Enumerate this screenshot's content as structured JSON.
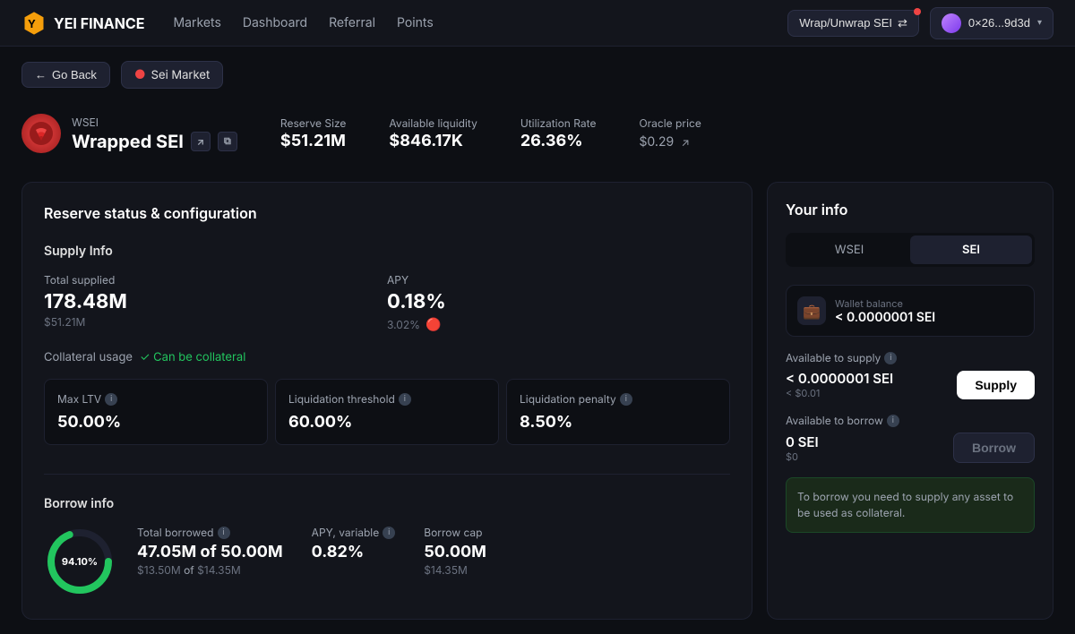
{
  "app": {
    "logo_text": "YEI FINANCE",
    "logo_icon": "⬡"
  },
  "nav": {
    "items": [
      {
        "id": "markets",
        "label": "Markets"
      },
      {
        "id": "dashboard",
        "label": "Dashboard"
      },
      {
        "id": "referral",
        "label": "Referral"
      },
      {
        "id": "points",
        "label": "Points"
      }
    ]
  },
  "header": {
    "wrap_btn_label": "Wrap/Unwrap SEI",
    "wallet_address": "0×26...9d3d"
  },
  "breadcrumb": {
    "back_label": "Go Back",
    "market_label": "Sei Market"
  },
  "asset": {
    "ticker": "WSEI",
    "name": "Wrapped SEI",
    "reserve_size_label": "Reserve Size",
    "reserve_size_value": "$51.21M",
    "available_liquidity_label": "Available liquidity",
    "available_liquidity_value": "$846.17K",
    "utilization_rate_label": "Utilization Rate",
    "utilization_rate_value": "26.36%",
    "oracle_price_label": "Oracle price",
    "oracle_price_value": "$0.29"
  },
  "left_panel": {
    "title": "Reserve status & configuration",
    "supply_info": {
      "section_label": "Supply Info",
      "total_supplied_label": "Total supplied",
      "total_supplied_value": "178.48M",
      "total_supplied_usd": "$51.21M",
      "apy_label": "APY",
      "apy_value": "0.18%",
      "apy_sub": "3.02%",
      "collateral_label": "Collateral usage",
      "collateral_badge": "✓ Can be collateral",
      "max_ltv_label": "Max LTV",
      "max_ltv_value": "50.00%",
      "liquidation_threshold_label": "Liquidation threshold",
      "liquidation_threshold_value": "60.00%",
      "liquidation_penalty_label": "Liquidation penalty",
      "liquidation_penalty_value": "8.50%"
    },
    "borrow_info": {
      "section_label": "Borrow info",
      "chart_percent": "94.10%",
      "total_borrowed_label": "Total borrowed",
      "total_borrowed_value": "47.05M of 50.00M",
      "total_borrowed_usd": "$13.50M",
      "total_borrowed_of_usd": "$14.35M",
      "apy_variable_label": "APY, variable",
      "apy_variable_value": "0.82%",
      "borrow_cap_label": "Borrow cap",
      "borrow_cap_value": "50.00M",
      "borrow_cap_usd": "$14.35M",
      "donut_fill": 94.1
    }
  },
  "right_panel": {
    "title": "Your info",
    "tab_wsei": "WSEI",
    "tab_sei": "SEI",
    "wallet_balance_label": "Wallet balance",
    "wallet_balance_value": "< 0.0000001 SEI",
    "available_to_supply_label": "Available to supply",
    "available_to_supply_value": "< 0.0000001 SEI",
    "available_to_supply_usd": "< $0.01",
    "supply_btn_label": "Supply",
    "available_to_borrow_label": "Available to borrow",
    "available_to_borrow_value": "0 SEI",
    "available_to_borrow_usd": "$0",
    "borrow_btn_label": "Borrow",
    "warning_text": "To borrow you need to supply any asset to be used as collateral."
  }
}
